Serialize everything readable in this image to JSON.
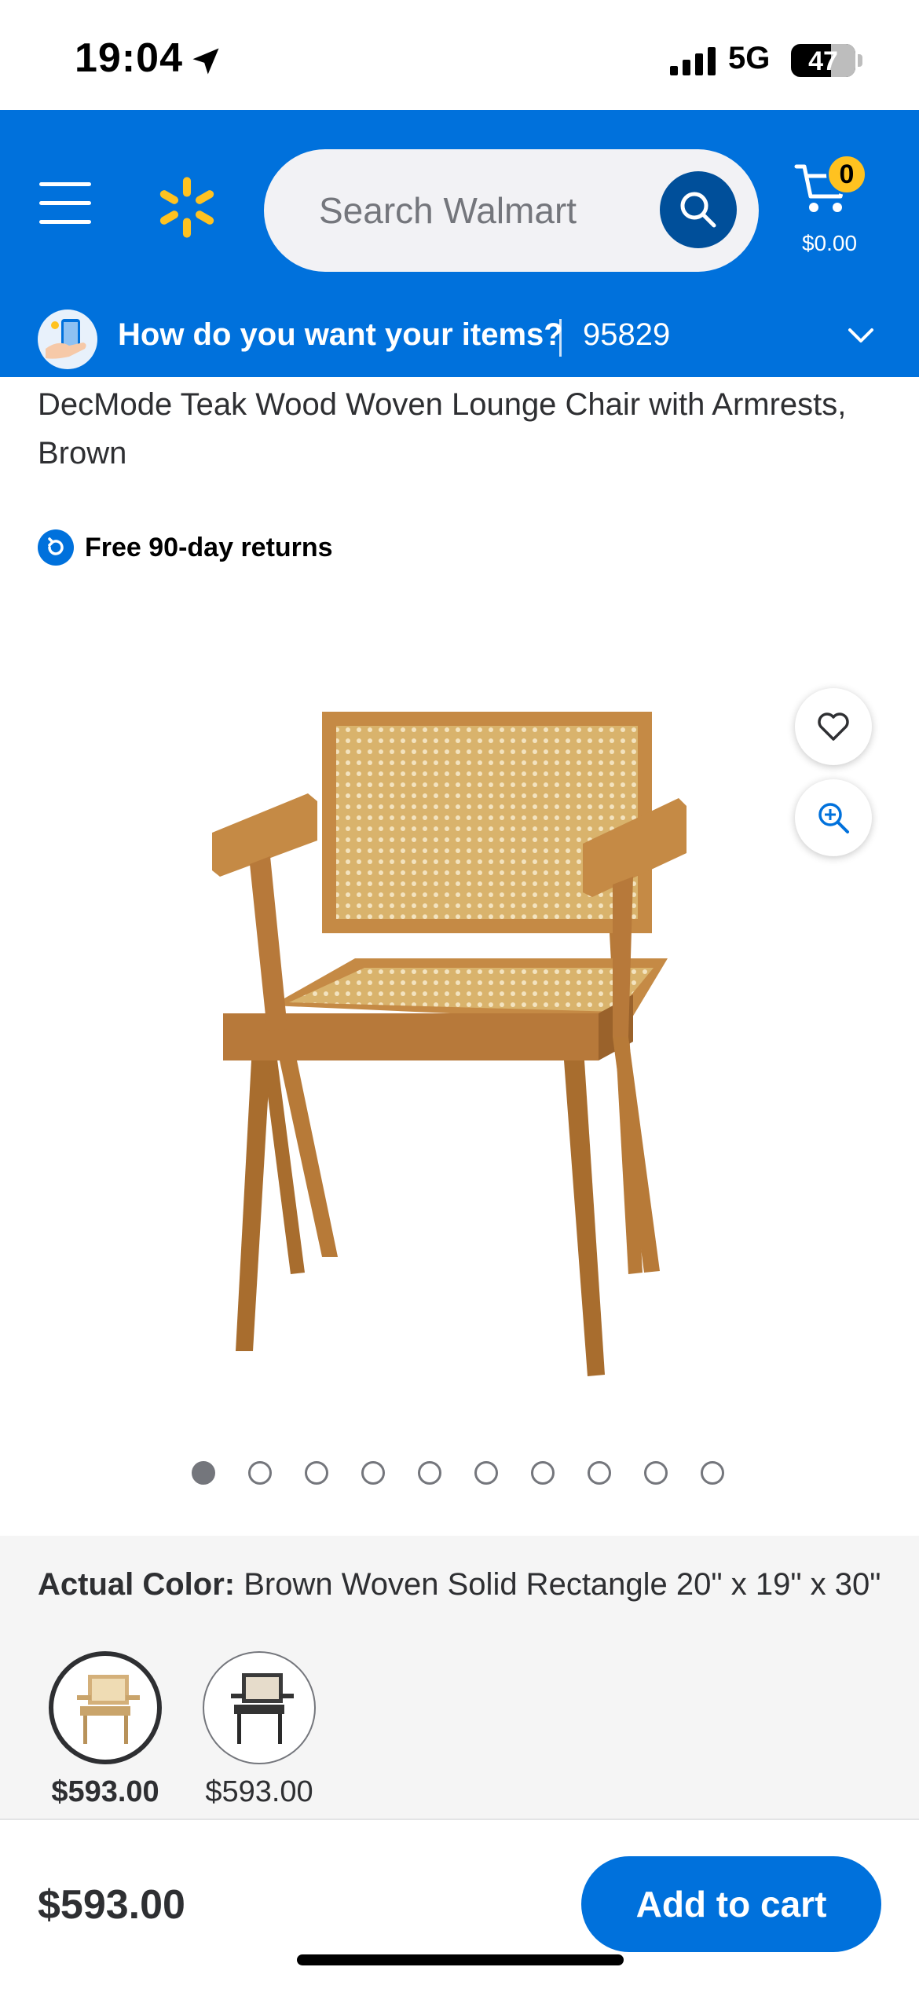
{
  "status_bar": {
    "time": "19:04",
    "network": "5G",
    "battery": "47",
    "icons": [
      "location-arrow-icon",
      "signal-bars-icon",
      "battery-icon"
    ]
  },
  "header": {
    "search_placeholder": "Search Walmart",
    "cart_count": "0",
    "cart_total": "$0.00",
    "fulfillment_question": "How do you want your items?",
    "zip_code": "95829",
    "colors": {
      "header_bg": "#0071dc",
      "spark": "#ffc220"
    }
  },
  "product": {
    "title": "DecMode Teak Wood Woven Lounge Chair with Armrests, Brown",
    "returns_text": "Free 90-day returns",
    "image_count": 10,
    "active_image_index": 0
  },
  "variants": {
    "label": "Actual Color:",
    "selected_value": "Brown Woven Solid Rectangle 20\" x 19\" x 30\"",
    "options": [
      {
        "price": "$593.00",
        "selected": true,
        "finish": "teak"
      },
      {
        "price": "$593.00",
        "selected": false,
        "finish": "black"
      }
    ]
  },
  "footer": {
    "price": "$593.00",
    "add_to_cart_label": "Add to cart",
    "colors": {
      "accent": "#0071dc"
    }
  }
}
